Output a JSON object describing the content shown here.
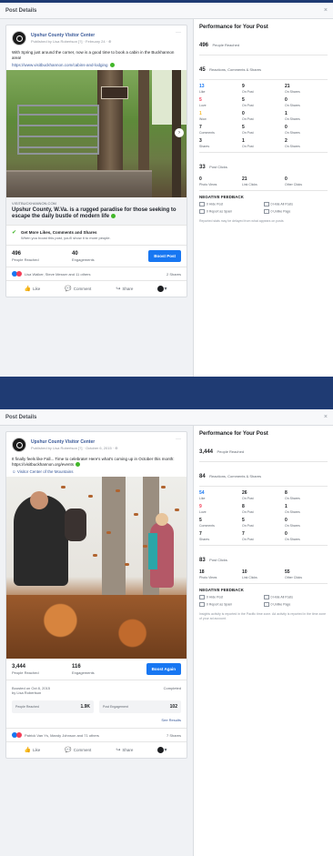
{
  "dialog1": {
    "title": "Post Details",
    "close": "×",
    "post": {
      "page_name": "Upshur County Visitor Center",
      "published_line": "Published by Lisa Robertson [?] · February 24 · ⊕",
      "caption": "With Spring just around the corner, now is a good time to book a cabin in the Buckhannon area!",
      "caption_link": "https://www.visitbuckhannon.com/cabins-and-lodging",
      "link_domain": "VISITBUCKHANNON.COM",
      "link_title": "Upshur County, W.Va. is a rugged paradise for those seeking to escape the daily bustle of modern life",
      "boost_tip_title": "Get More Likes, Comments and Shares",
      "boost_tip_desc": "When you boost this post, you'll show it to more people.",
      "reached_value": "496",
      "reached_label": "People Reached",
      "engagements_value": "40",
      "engagements_label": "Engagements",
      "boost_label": "Boost Post",
      "reactions_text": "Lisa Walker, Steve Messer and 11 others",
      "shares_text": "2 Shares",
      "like_label": "Like",
      "comment_label": "Comment",
      "share_label": "Share"
    },
    "performance": {
      "title": "Performance for Your Post",
      "reached": "496",
      "reached_label": "People Reached",
      "engagement_line": "45",
      "engagement_label": "Reactions, Comments & Shares",
      "grid": [
        {
          "n": "13",
          "l": "Like",
          "c": "blue"
        },
        {
          "n": "9",
          "l": "On Post",
          "c": ""
        },
        {
          "n": "21",
          "l": "On Shares",
          "c": ""
        },
        {
          "n": "5",
          "l": "Love",
          "c": "red"
        },
        {
          "n": "5",
          "l": "On Post",
          "c": ""
        },
        {
          "n": "0",
          "l": "On Shares",
          "c": ""
        },
        {
          "n": "1",
          "l": "Wow",
          "c": "gold"
        },
        {
          "n": "0",
          "l": "On Post",
          "c": ""
        },
        {
          "n": "1",
          "l": "On Shares",
          "c": ""
        },
        {
          "n": "7",
          "l": "Comments",
          "c": ""
        },
        {
          "n": "5",
          "l": "On Post",
          "c": ""
        },
        {
          "n": "0",
          "l": "On Shares",
          "c": ""
        },
        {
          "n": "3",
          "l": "Shares",
          "c": ""
        },
        {
          "n": "1",
          "l": "On Post",
          "c": ""
        },
        {
          "n": "2",
          "l": "On Shares",
          "c": ""
        }
      ],
      "clicks_value": "33",
      "clicks_label": "Post Clicks",
      "clicks_grid": [
        {
          "n": "0",
          "l": "Photo Views"
        },
        {
          "n": "21",
          "l": "Link Clicks"
        },
        {
          "n": "0",
          "l": "Other Clicks"
        }
      ],
      "negative_title": "NEGATIVE FEEDBACK",
      "negative": [
        "0 Hide Post",
        "0 Hide All Posts",
        "0 Report as Spam",
        "0 Unlike Page"
      ],
      "note": "Reported stats may be delayed from what appears on posts"
    }
  },
  "dialog2": {
    "title": "Post Details",
    "close": "×",
    "post": {
      "page_name": "Upshur County Visitor Center",
      "published_line": "Published by Lisa Robertson [?] · October 6, 2015 · ⊕",
      "caption": "It finally feels like Fall... Time to celebrate! Here's what's coming up in October this month: https://visitbuckhannon.org/events",
      "extra_link": "Visitor Center of the Mountains",
      "reached_value": "3,444",
      "reached_label": "People Reached",
      "engagements_value": "116",
      "engagements_label": "Engagements",
      "boost_label": "Boost Again",
      "boosted_line": "Boosted on Oct 8, 2015",
      "boosted_by": "by Lisa Robertson",
      "completed": "Completed",
      "people_reached_label": "People Reached",
      "people_reached_value": "1.9K",
      "post_engagement_label": "Post Engagement",
      "post_engagement_value": "102",
      "see_results": "See Results",
      "reactions_text": "Patrick Van Ys, Mandy Johnson and 71 others",
      "shares_text": "7 Shares",
      "like_label": "Like",
      "comment_label": "Comment",
      "share_label": "Share"
    },
    "performance": {
      "title": "Performance for Your Post",
      "reached": "3,444",
      "reached_label": "People Reached",
      "engagement_line": "84",
      "engagement_label": "Reactions, Comments & Shares",
      "grid": [
        {
          "n": "54",
          "l": "Like",
          "c": "blue"
        },
        {
          "n": "26",
          "l": "On Post",
          "c": ""
        },
        {
          "n": "8",
          "l": "On Shares",
          "c": ""
        },
        {
          "n": "9",
          "l": "Love",
          "c": "red"
        },
        {
          "n": "8",
          "l": "On Post",
          "c": ""
        },
        {
          "n": "1",
          "l": "On Shares",
          "c": ""
        },
        {
          "n": "5",
          "l": "Comments",
          "c": ""
        },
        {
          "n": "5",
          "l": "On Post",
          "c": ""
        },
        {
          "n": "0",
          "l": "On Shares",
          "c": ""
        },
        {
          "n": "7",
          "l": "Shares",
          "c": ""
        },
        {
          "n": "7",
          "l": "On Post",
          "c": ""
        },
        {
          "n": "0",
          "l": "On Shares",
          "c": ""
        }
      ],
      "clicks_value": "83",
      "clicks_label": "Post Clicks",
      "clicks_grid": [
        {
          "n": "18",
          "l": "Photo Views"
        },
        {
          "n": "10",
          "l": "Link Clicks"
        },
        {
          "n": "55",
          "l": "Other Clicks"
        }
      ],
      "negative_title": "NEGATIVE FEEDBACK",
      "negative": [
        "0 Hide Post",
        "0 Hide All Posts",
        "0 Report as Spam",
        "0 Unlike Page"
      ],
      "note": "Insights activity is reported in the Pacific time zone. Ad activity is reported in the time zone of your ad account."
    }
  },
  "colors": {
    "accent": "#1877f2",
    "frame": "#1f3b73",
    "link": "#385898"
  }
}
